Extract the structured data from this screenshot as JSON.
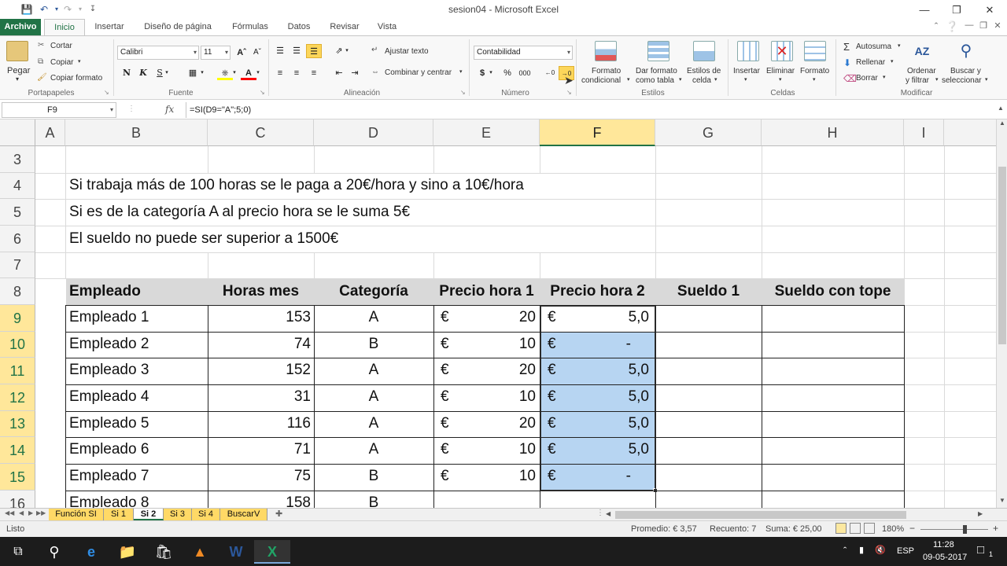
{
  "window": {
    "title": "sesion04 - Microsoft Excel",
    "controls": [
      "minimize-icon",
      "restore-icon",
      "close-icon"
    ]
  },
  "quick_access": [
    "save-icon",
    "undo-icon",
    "redo-icon",
    "customize-icon"
  ],
  "tabs": [
    "Archivo",
    "Inicio",
    "Insertar",
    "Diseño de página",
    "Fórmulas",
    "Datos",
    "Revisar",
    "Vista"
  ],
  "ribbon": {
    "portapapeles": {
      "label": "Portapapeles",
      "pegar": "Pegar",
      "cortar": "Cortar",
      "copiar": "Copiar",
      "copiar_formato": "Copiar formato"
    },
    "fuente": {
      "label": "Fuente",
      "font": "Calibri",
      "size": "11",
      "bold": "N",
      "italic": "K",
      "underline": "S"
    },
    "alineacion": {
      "label": "Alineación",
      "ajustar": "Ajustar texto",
      "combinar": "Combinar y centrar"
    },
    "numero": {
      "label": "Número",
      "format": "Contabilidad",
      "currency": "$",
      "percent": "%",
      "thousands": "000"
    },
    "estilos": {
      "label": "Estilos",
      "formato_condicional": [
        "Formato",
        "condicional"
      ],
      "dar_formato": [
        "Dar formato",
        "como tabla"
      ],
      "estilos_celda": [
        "Estilos de",
        "celda"
      ]
    },
    "celdas": {
      "label": "Celdas",
      "insertar": "Insertar",
      "eliminar": "Eliminar",
      "formato": "Formato"
    },
    "modificar": {
      "label": "Modificar",
      "autosuma": "Autosuma",
      "rellenar": "Rellenar",
      "borrar": "Borrar",
      "ordenar": [
        "Ordenar",
        "y filtrar"
      ],
      "buscar": [
        "Buscar y",
        "seleccionar"
      ]
    }
  },
  "formula_bar": {
    "name_box": "F9",
    "fx": "fx",
    "formula": "=SI(D9=\"A\";5;0)"
  },
  "columns": [
    "A",
    "B",
    "C",
    "D",
    "E",
    "F",
    "G",
    "H",
    "I"
  ],
  "selected_column": "F",
  "rows": [
    "3",
    "4",
    "5",
    "6",
    "7",
    "8",
    "9",
    "10",
    "11",
    "12",
    "13",
    "14",
    "15",
    "16"
  ],
  "notes": [
    "Si trabaja más de 100 horas se le paga a 20€/hora y sino a 10€/hora",
    "Si es de la categoría A al  precio hora se le suma 5€",
    "El sueldo no puede ser superior a 1500€"
  ],
  "table_headers": [
    "Empleado",
    "Horas mes",
    "Categoría",
    "Precio hora 1",
    "Precio hora 2",
    "Sueldo 1",
    "Sueldo con tope"
  ],
  "table_rows": [
    {
      "empleado": "Empleado 1",
      "horas": "153",
      "cat": "A",
      "cur1": "€",
      "p1": "20",
      "cur2": "€",
      "p2": "5,0"
    },
    {
      "empleado": "Empleado 2",
      "horas": "74",
      "cat": "B",
      "cur1": "€",
      "p1": "10",
      "cur2": "€",
      "p2": "-"
    },
    {
      "empleado": "Empleado 3",
      "horas": "152",
      "cat": "A",
      "cur1": "€",
      "p1": "20",
      "cur2": "€",
      "p2": "5,0"
    },
    {
      "empleado": "Empleado 4",
      "horas": "31",
      "cat": "A",
      "cur1": "€",
      "p1": "10",
      "cur2": "€",
      "p2": "5,0"
    },
    {
      "empleado": "Empleado 5",
      "horas": "116",
      "cat": "A",
      "cur1": "€",
      "p1": "20",
      "cur2": "€",
      "p2": "5,0"
    },
    {
      "empleado": "Empleado 6",
      "horas": "71",
      "cat": "A",
      "cur1": "€",
      "p1": "10",
      "cur2": "€",
      "p2": "5,0"
    },
    {
      "empleado": "Empleado 7",
      "horas": "75",
      "cat": "B",
      "cur1": "€",
      "p1": "10",
      "cur2": "€",
      "p2": "-"
    },
    {
      "empleado": "Empleado 8",
      "horas": "158",
      "cat": "B",
      "cur1": "",
      "p1": "",
      "cur2": "",
      "p2": ""
    }
  ],
  "sheet_tabs": [
    {
      "name": "Función SI",
      "color": "#ffd966",
      "active": false
    },
    {
      "name": "Si 1",
      "color": "#ffd966",
      "active": false
    },
    {
      "name": "Si 2",
      "color": "#ffffff",
      "active": true
    },
    {
      "name": "Si 3",
      "color": "#ffd966",
      "active": false
    },
    {
      "name": "Si 4",
      "color": "#ffd966",
      "active": false
    },
    {
      "name": "BuscarV",
      "color": "#ffd966",
      "active": false
    }
  ],
  "status": {
    "ready": "Listo",
    "average": "Promedio:  € 3,57",
    "count": "Recuento: 7",
    "sum": "Suma:  € 25,00",
    "zoom": "180%"
  },
  "taskbar": {
    "lang": "ESP",
    "time": "11:28",
    "date": "09-05-2017",
    "notifications": "1"
  }
}
